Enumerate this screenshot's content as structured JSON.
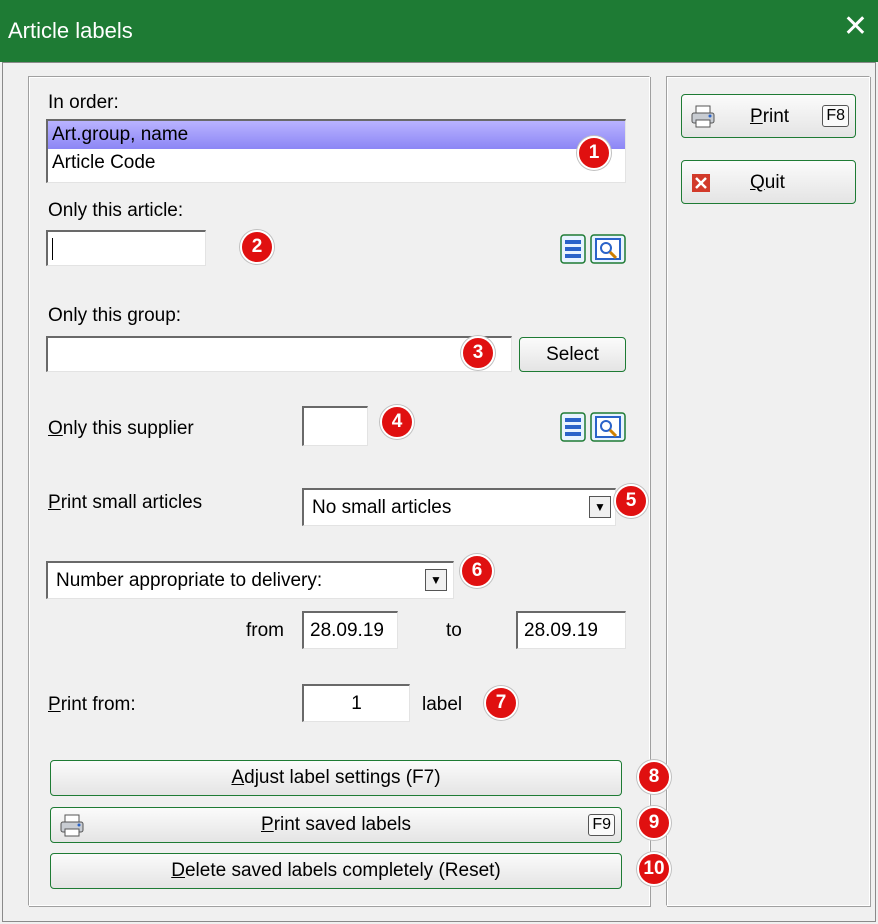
{
  "window": {
    "title": "Article labels",
    "close": "✕"
  },
  "order": {
    "label": "In order:",
    "items": [
      "Art.group, name",
      "Article Code"
    ],
    "selected_index": 0
  },
  "article": {
    "label": "Only this article:",
    "value": ""
  },
  "group": {
    "label": "Only this group:",
    "value": "",
    "select_button": "Select"
  },
  "supplier": {
    "label": "Only this supplier",
    "value": ""
  },
  "small_articles": {
    "label": "Print small articles",
    "value": "No small articles"
  },
  "number_mode": {
    "value": "Number appropriate to delivery:"
  },
  "date_range": {
    "from_label": "from",
    "from": "28.09.19",
    "to_label": "to",
    "to": "28.09.19"
  },
  "print_from": {
    "label": "Print from:",
    "value": "1",
    "suffix": "label"
  },
  "buttons": {
    "adjust": "Adjust label settings (F7)",
    "print_saved": "Print saved labels",
    "print_saved_key": "F9",
    "delete_saved": "Delete saved labels completely (Reset)",
    "print": "Print",
    "print_key": "F8",
    "quit": "Quit"
  },
  "badges": [
    "1",
    "2",
    "3",
    "4",
    "5",
    "6",
    "7",
    "8",
    "9",
    "10"
  ],
  "colors": {
    "titlebar": "#1e7b34",
    "badge": "#e01010",
    "selection": "#9a94f8"
  }
}
